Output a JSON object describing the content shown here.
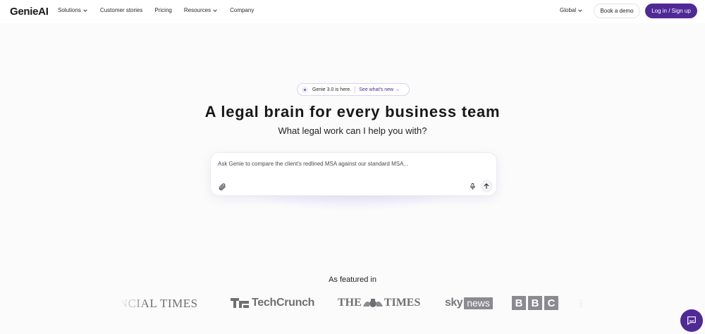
{
  "brand": {
    "name": "GenieAI"
  },
  "nav": {
    "items": [
      {
        "label": "Solutions",
        "has_dropdown": true
      },
      {
        "label": "Customer stories",
        "has_dropdown": false
      },
      {
        "label": "Pricing",
        "has_dropdown": false
      },
      {
        "label": "Resources",
        "has_dropdown": true
      },
      {
        "label": "Company",
        "has_dropdown": false
      }
    ],
    "region_label": "Global",
    "demo_label": "Book a demo",
    "login_label": "Log in / Sign up"
  },
  "announcement": {
    "text": "Genie 3.0 is here.",
    "link": "See what's new →"
  },
  "hero": {
    "title": "A legal brain for every business team",
    "subtitle": "What legal work can I help you with?"
  },
  "prompt": {
    "placeholder": "Ask Genie to compare the client's redlined MSA against our standard MSA...",
    "value": ""
  },
  "featured": {
    "title": "As featured in",
    "logos": {
      "ft": "ANCIAL TIMES",
      "techcrunch": "TechCrunch",
      "times_left": "THE",
      "times_right": "TIMES",
      "sky": "sky",
      "sky_news": "news",
      "bbc": [
        "B",
        "B",
        "C"
      ],
      "partial": "F"
    }
  },
  "colors": {
    "accent": "#4f2a96",
    "background": "#fbfbfb",
    "logo_gray": "#6f6f74"
  },
  "icons": {
    "attach": "paperclip-icon",
    "mic": "microphone-icon",
    "send": "arrow-up-icon",
    "chat": "chat-bubble-icon"
  }
}
